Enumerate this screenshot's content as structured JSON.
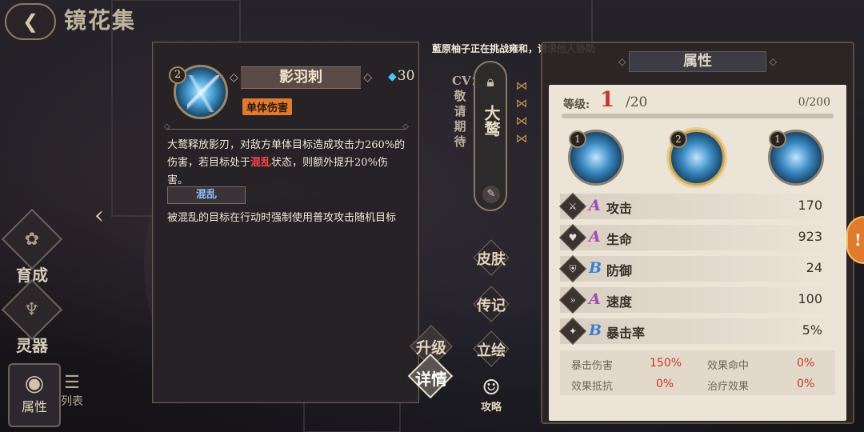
{
  "page_title": "镜花集",
  "notification": "藍原柚子正在挑战雍和，请求他人协助",
  "left_nav": {
    "items": [
      {
        "label": "育成",
        "icon": "flower-icon"
      },
      {
        "label": "灵器",
        "icon": "relic-icon"
      }
    ],
    "bottom": {
      "label": "属性",
      "icon": "eye-icon"
    },
    "list": {
      "label": "列表"
    }
  },
  "skill_popup": {
    "level": "2",
    "name": "影羽刺",
    "cost": "30",
    "tag": "单体伤害",
    "desc_part1": "大鹜释放影刃，对敌方单体目标造成攻击力260%的伤害，若目标处于",
    "desc_highlight": "混乱",
    "desc_part2": "状态，则额外提升20%伤害。",
    "status_name": "混乱",
    "status_desc": "被混乱的目标在行动时强制使用普攻攻击随机目标"
  },
  "character": {
    "cv_text": "CV：敬请期待",
    "name": "大鹜"
  },
  "side_buttons": {
    "skin": "皮肤",
    "bio": "传记",
    "art": "立绘",
    "upgrade": "升级",
    "detail": "详情",
    "guide": "攻略"
  },
  "attributes": {
    "header": "属性",
    "level_label": "等级:",
    "level": "1",
    "level_max": "/20",
    "exp": "0/200",
    "exp_ratio": 0,
    "skills": [
      {
        "level": "1"
      },
      {
        "level": "2"
      },
      {
        "level": "1"
      }
    ],
    "stats": [
      {
        "grade": "A",
        "name": "攻击",
        "value": "170",
        "icon": "attack-icon"
      },
      {
        "grade": "A",
        "name": "生命",
        "value": "923",
        "icon": "heart-icon"
      },
      {
        "grade": "B",
        "name": "防御",
        "value": "24",
        "icon": "shield-icon"
      },
      {
        "grade": "A",
        "name": "速度",
        "value": "100",
        "icon": "speed-icon"
      },
      {
        "grade": "B",
        "name": "暴击率",
        "value": "5%",
        "icon": "crit-icon"
      }
    ],
    "sub_stats": [
      {
        "name": "暴击伤害",
        "value": "150%"
      },
      {
        "name": "效果命中",
        "value": "0%"
      },
      {
        "name": "效果抵抗",
        "value": "0%"
      },
      {
        "name": "治疗效果",
        "value": "0%"
      }
    ]
  }
}
